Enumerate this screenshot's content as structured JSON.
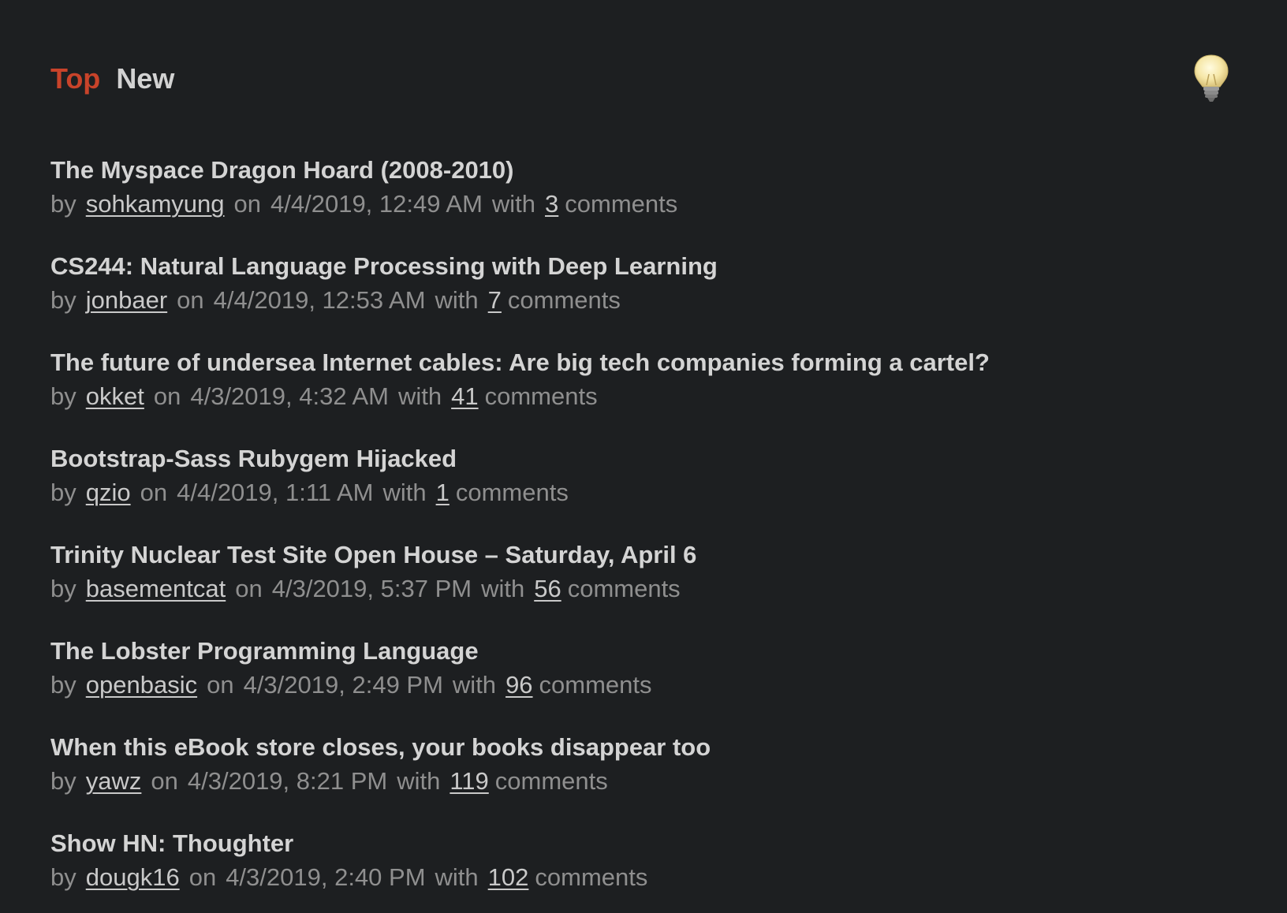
{
  "nav": {
    "tabs": [
      {
        "label": "Top",
        "active": true
      },
      {
        "label": "New",
        "active": false
      }
    ],
    "theme_toggle_icon": "lightbulb-icon"
  },
  "meta_labels": {
    "by": "by",
    "on": "on",
    "with": "with",
    "comments": "comments"
  },
  "colors": {
    "background": "#1d1f21",
    "active_tab": "#c8432a",
    "text": "#d2d2d2",
    "muted": "#8f8f8f"
  },
  "stories": [
    {
      "title": "The Myspace Dragon Hoard (2008-2010)",
      "user": "sohkamyung",
      "date": "4/4/2019, 12:49 AM",
      "comments": "3"
    },
    {
      "title": "CS244: Natural Language Processing with Deep Learning",
      "user": "jonbaer",
      "date": "4/4/2019, 12:53 AM",
      "comments": "7"
    },
    {
      "title": "The future of undersea Internet cables: Are big tech companies forming a cartel?",
      "user": "okket",
      "date": "4/3/2019, 4:32 AM",
      "comments": "41"
    },
    {
      "title": "Bootstrap-Sass Rubygem Hijacked",
      "user": "qzio",
      "date": "4/4/2019, 1:11 AM",
      "comments": "1"
    },
    {
      "title": "Trinity Nuclear Test Site Open House – Saturday, April 6",
      "user": "basementcat",
      "date": "4/3/2019, 5:37 PM",
      "comments": "56"
    },
    {
      "title": "The Lobster Programming Language",
      "user": "openbasic",
      "date": "4/3/2019, 2:49 PM",
      "comments": "96"
    },
    {
      "title": "When this eBook store closes, your books disappear too",
      "user": "yawz",
      "date": "4/3/2019, 8:21 PM",
      "comments": "119"
    },
    {
      "title": "Show HN: Thoughter",
      "user": "dougk16",
      "date": "4/3/2019, 2:40 PM",
      "comments": "102"
    }
  ]
}
